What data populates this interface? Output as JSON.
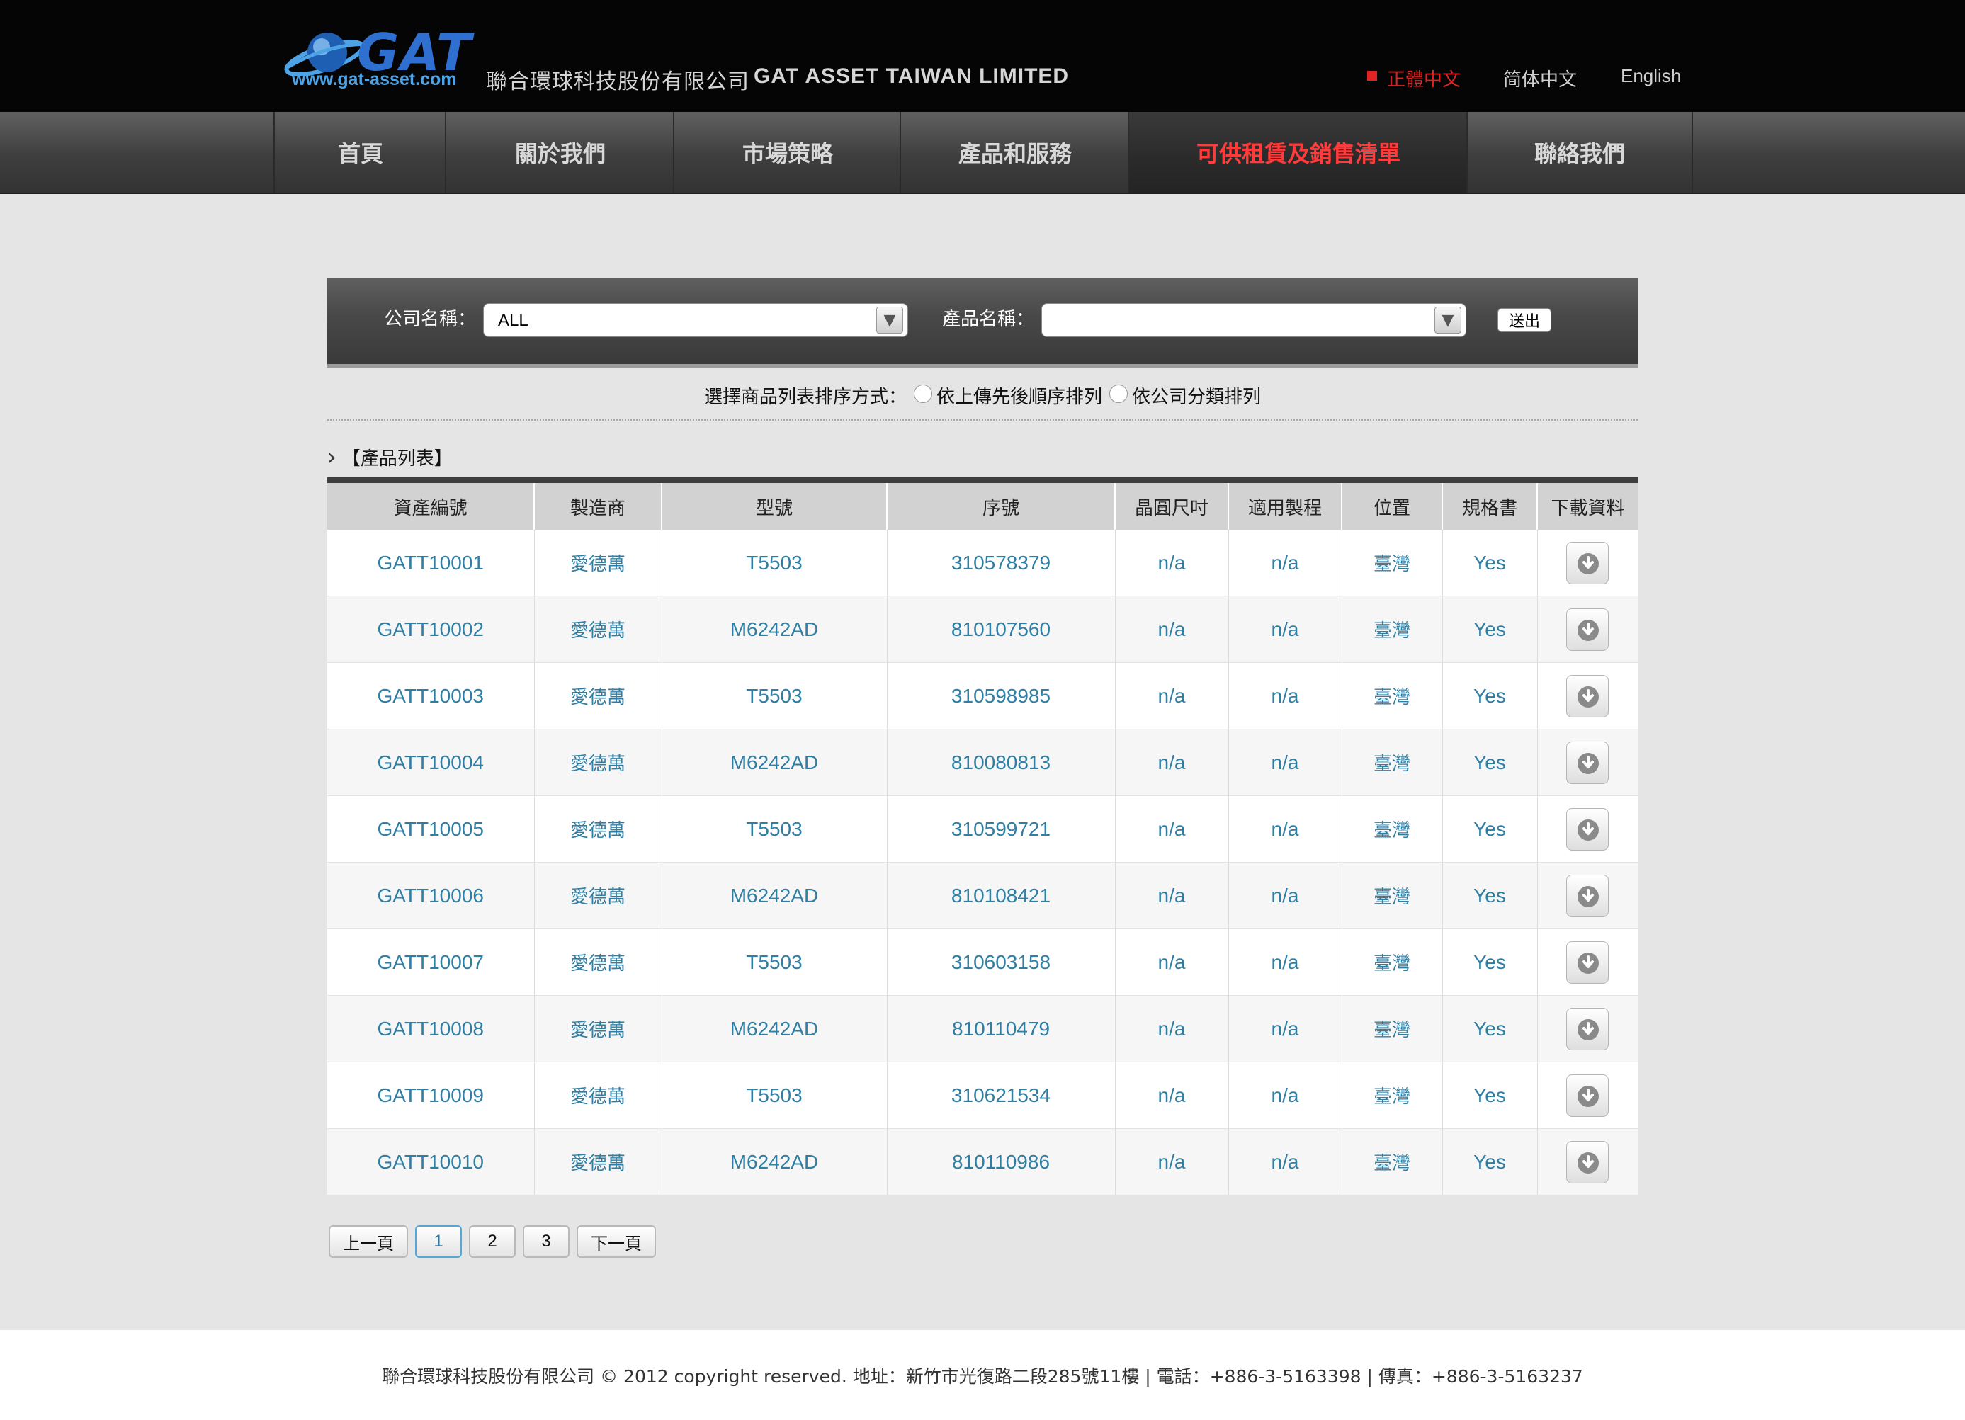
{
  "header": {
    "logo_text": "GAT",
    "logo_url": "www.gat-asset.com",
    "company_name_cn": "聯合環球科技股份有限公司",
    "company_name_en": "GAT ASSET TAIWAN LIMITED",
    "languages": [
      "正體中文",
      "简体中文",
      "English"
    ],
    "active_language": "正體中文"
  },
  "nav": {
    "items": [
      "首頁",
      "關於我們",
      "市場策略",
      "產品和服務",
      "可供租賃及銷售清單",
      "聯絡我們"
    ],
    "active": "可供租賃及銷售清單"
  },
  "search": {
    "company_label": "公司名稱：",
    "company_value": "ALL",
    "product_label": "產品名稱：",
    "product_value": "",
    "submit_label": "送出"
  },
  "sort": {
    "label": "選擇商品列表排序方式：",
    "option_upload_order": "依上傳先後順序排列",
    "option_company": "依公司分類排列"
  },
  "product_list": {
    "title": "【產品列表】",
    "columns": [
      "資產編號",
      "製造商",
      "型號",
      "序號",
      "晶圓尺吋",
      "適用製程",
      "位置",
      "規格書",
      "下載資料"
    ],
    "rows": [
      [
        "GATT10001",
        "愛德萬",
        "T5503",
        "310578379",
        "n/a",
        "n/a",
        "臺灣",
        "Yes"
      ],
      [
        "GATT10002",
        "愛德萬",
        "M6242AD",
        "810107560",
        "n/a",
        "n/a",
        "臺灣",
        "Yes"
      ],
      [
        "GATT10003",
        "愛德萬",
        "T5503",
        "310598985",
        "n/a",
        "n/a",
        "臺灣",
        "Yes"
      ],
      [
        "GATT10004",
        "愛德萬",
        "M6242AD",
        "810080813",
        "n/a",
        "n/a",
        "臺灣",
        "Yes"
      ],
      [
        "GATT10005",
        "愛德萬",
        "T5503",
        "310599721",
        "n/a",
        "n/a",
        "臺灣",
        "Yes"
      ],
      [
        "GATT10006",
        "愛德萬",
        "M6242AD",
        "810108421",
        "n/a",
        "n/a",
        "臺灣",
        "Yes"
      ],
      [
        "GATT10007",
        "愛德萬",
        "T5503",
        "310603158",
        "n/a",
        "n/a",
        "臺灣",
        "Yes"
      ],
      [
        "GATT10008",
        "愛德萬",
        "M6242AD",
        "810110479",
        "n/a",
        "n/a",
        "臺灣",
        "Yes"
      ],
      [
        "GATT10009",
        "愛德萬",
        "T5503",
        "310621534",
        "n/a",
        "n/a",
        "臺灣",
        "Yes"
      ],
      [
        "GATT10010",
        "愛德萬",
        "M6242AD",
        "810110986",
        "n/a",
        "n/a",
        "臺灣",
        "Yes"
      ]
    ]
  },
  "pagination": {
    "prev_label": "上一頁",
    "pages": [
      "1",
      "2",
      "3"
    ],
    "current_page": "1",
    "next_label": "下一頁"
  },
  "footer": {
    "text": "聯合環球科技股份有限公司 © 2012 copyright reserved. 地址：新竹市光復路二段285號11樓 | 電話：+886-3-5163398 | 傳真：+886-3-5163237"
  },
  "icons": {
    "download": "download-icon",
    "dropdown": "chevron-down-icon",
    "section": "chevron-right-icon"
  },
  "colors": {
    "nav_active": "#ff3b3b",
    "language_active": "#e02424",
    "link": "#2f7ea4",
    "header_bg": "#050505"
  }
}
